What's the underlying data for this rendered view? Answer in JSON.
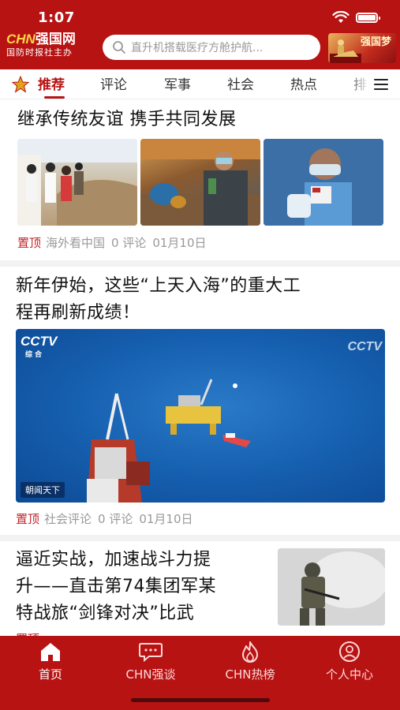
{
  "status_bar": {
    "time": "1:07"
  },
  "header": {
    "logo": {
      "brand": "CHN强国网",
      "tagline": "国防时报社主办"
    },
    "search": {
      "placeholder": "直升机搭载医疗方舱护航..."
    },
    "promo": {
      "text": "强国梦"
    }
  },
  "tabs": [
    {
      "label": "推荐",
      "active": true
    },
    {
      "label": "评论"
    },
    {
      "label": "军事"
    },
    {
      "label": "社会"
    },
    {
      "label": "热点"
    },
    {
      "label": "排"
    }
  ],
  "articles": [
    {
      "title": "继承传统友谊 携手共同发展",
      "pinned_label": "置顶",
      "source": "海外看中国",
      "comments": "0 评论",
      "date": "01月10日"
    },
    {
      "title_line1": "新年伊始，这些“上天入海”的重大工",
      "title_line2": "程再刷新成绩！",
      "pinned_label": "置顶",
      "source": "社会评论",
      "comments": "0 评论",
      "date": "01月10日",
      "image": {
        "channel": "CCTV",
        "channel_sub": "综合",
        "watermark": "CCTV",
        "ticker": "朝闻天下"
      }
    },
    {
      "title_line1": "逼近实战，加速战斗力提",
      "title_line2": "升——直击第74集团军某",
      "title_line3": "特战旅“剑锋对决”比武",
      "pinned_label": "置顶"
    }
  ],
  "bottom_nav": [
    {
      "label": "首页",
      "icon": "home-icon",
      "active": true
    },
    {
      "label": "CHN强谈",
      "icon": "chat-icon"
    },
    {
      "label": "CHN热榜",
      "icon": "flame-icon"
    },
    {
      "label": "个人中心",
      "icon": "user-icon"
    }
  ],
  "colors": {
    "brand_red": "#b81313",
    "pin_red": "#c0262a",
    "meta_gray": "#999999"
  }
}
